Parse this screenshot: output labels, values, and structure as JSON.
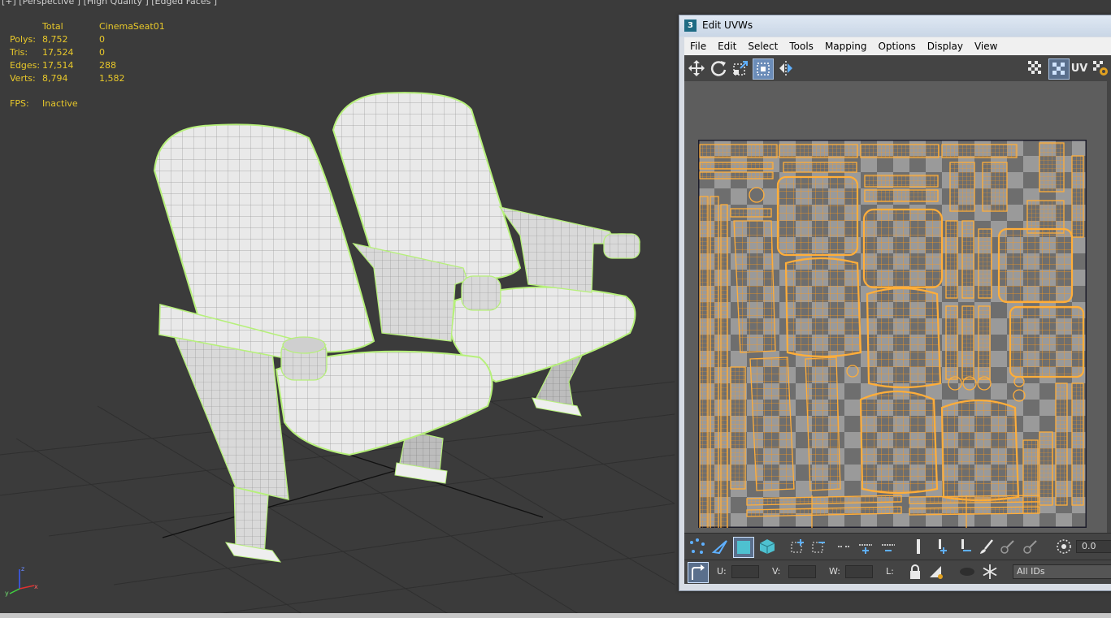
{
  "viewport": {
    "label": "[+] [Perspective ] [High Quality ] [Edged Faces ]",
    "stats": {
      "headers": [
        "",
        "Total",
        "CinemaSeat01"
      ],
      "rows": [
        {
          "label": "Polys:",
          "total": "8,752",
          "selected": "0"
        },
        {
          "label": "Tris:",
          "total": "17,524",
          "selected": "0"
        },
        {
          "label": "Edges:",
          "total": "17,514",
          "selected": "288"
        },
        {
          "label": "Verts:",
          "total": "8,794",
          "selected": "1,582"
        }
      ],
      "fps_label": "FPS:",
      "fps_value": "Inactive"
    },
    "axis": {
      "x": "x",
      "y": "y",
      "z": "z"
    }
  },
  "uvw_window": {
    "icon": "3",
    "title": "Edit UVWs",
    "menu": [
      "File",
      "Edit",
      "Select",
      "Tools",
      "Mapping",
      "Options",
      "Display",
      "View"
    ],
    "toolbar_uv_label": "UV",
    "bottom": {
      "u_label": "U:",
      "v_label": "V:",
      "w_label": "W:",
      "l_label": "L:",
      "spinner_value": "0.0",
      "ids_dropdown": "All IDs"
    }
  },
  "colors": {
    "viewport_bg": "#3b3b3b",
    "stats_text": "#e8c82a",
    "wire_green": "#b6f07a",
    "uv_orange": "#ff9a1a",
    "titlebar": "#c9d6e6"
  }
}
